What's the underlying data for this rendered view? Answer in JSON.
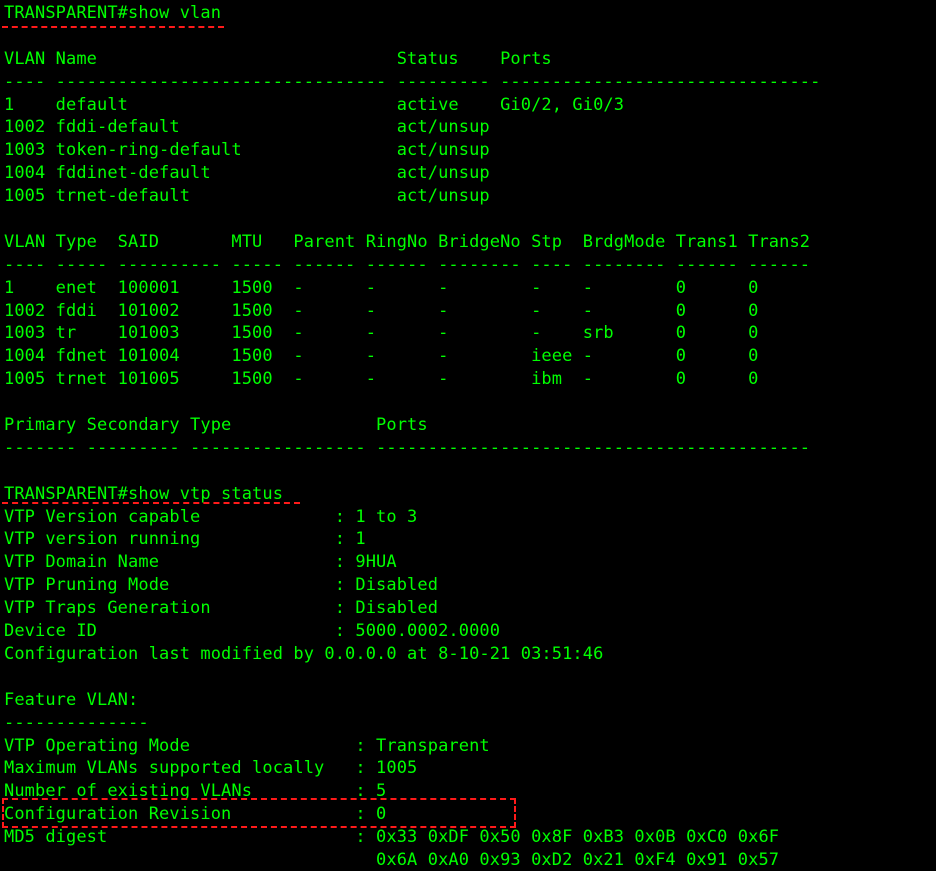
{
  "terminal": {
    "lines": [
      "TRANSPARENT#show vlan",
      "",
      "VLAN Name                             Status    Ports",
      "---- -------------------------------- --------- -------------------------------",
      "1    default                          active    Gi0/2, Gi0/3",
      "1002 fddi-default                     act/unsup",
      "1003 token-ring-default               act/unsup",
      "1004 fddinet-default                  act/unsup",
      "1005 trnet-default                    act/unsup",
      "",
      "VLAN Type  SAID       MTU   Parent RingNo BridgeNo Stp  BrdgMode Trans1 Trans2",
      "---- ----- ---------- ----- ------ ------ -------- ---- -------- ------ ------",
      "1    enet  100001     1500  -      -      -        -    -        0      0",
      "1002 fddi  101002     1500  -      -      -        -    -        0      0",
      "1003 tr    101003     1500  -      -      -        -    srb      0      0",
      "1004 fdnet 101004     1500  -      -      -        ieee -        0      0",
      "1005 trnet 101005     1500  -      -      -        ibm  -        0      0",
      "",
      "Primary Secondary Type              Ports",
      "------- --------- ----------------- ------------------------------------------",
      "",
      "TRANSPARENT#show vtp status",
      "VTP Version capable             : 1 to 3",
      "VTP version running             : 1",
      "VTP Domain Name                 : 9HUA",
      "VTP Pruning Mode                : Disabled",
      "VTP Traps Generation            : Disabled",
      "Device ID                       : 5000.0002.0000",
      "Configuration last modified by 0.0.0.0 at 8-10-21 03:51:46",
      "",
      "Feature VLAN:",
      "--------------",
      "VTP Operating Mode                : Transparent",
      "Maximum VLANs supported locally   : 1005",
      "Number of existing VLANs          : 5",
      "Configuration Revision            : 0",
      "MD5 digest                        : 0x33 0xDF 0x50 0x8F 0xB3 0x0B 0xC0 0x6F",
      "                                    0x6A 0xA0 0x93 0xD2 0x21 0xF4 0x91 0x57"
    ]
  },
  "colors": {
    "background": "#000000",
    "text": "#00ff00",
    "annotation": "#ff1a1a"
  }
}
